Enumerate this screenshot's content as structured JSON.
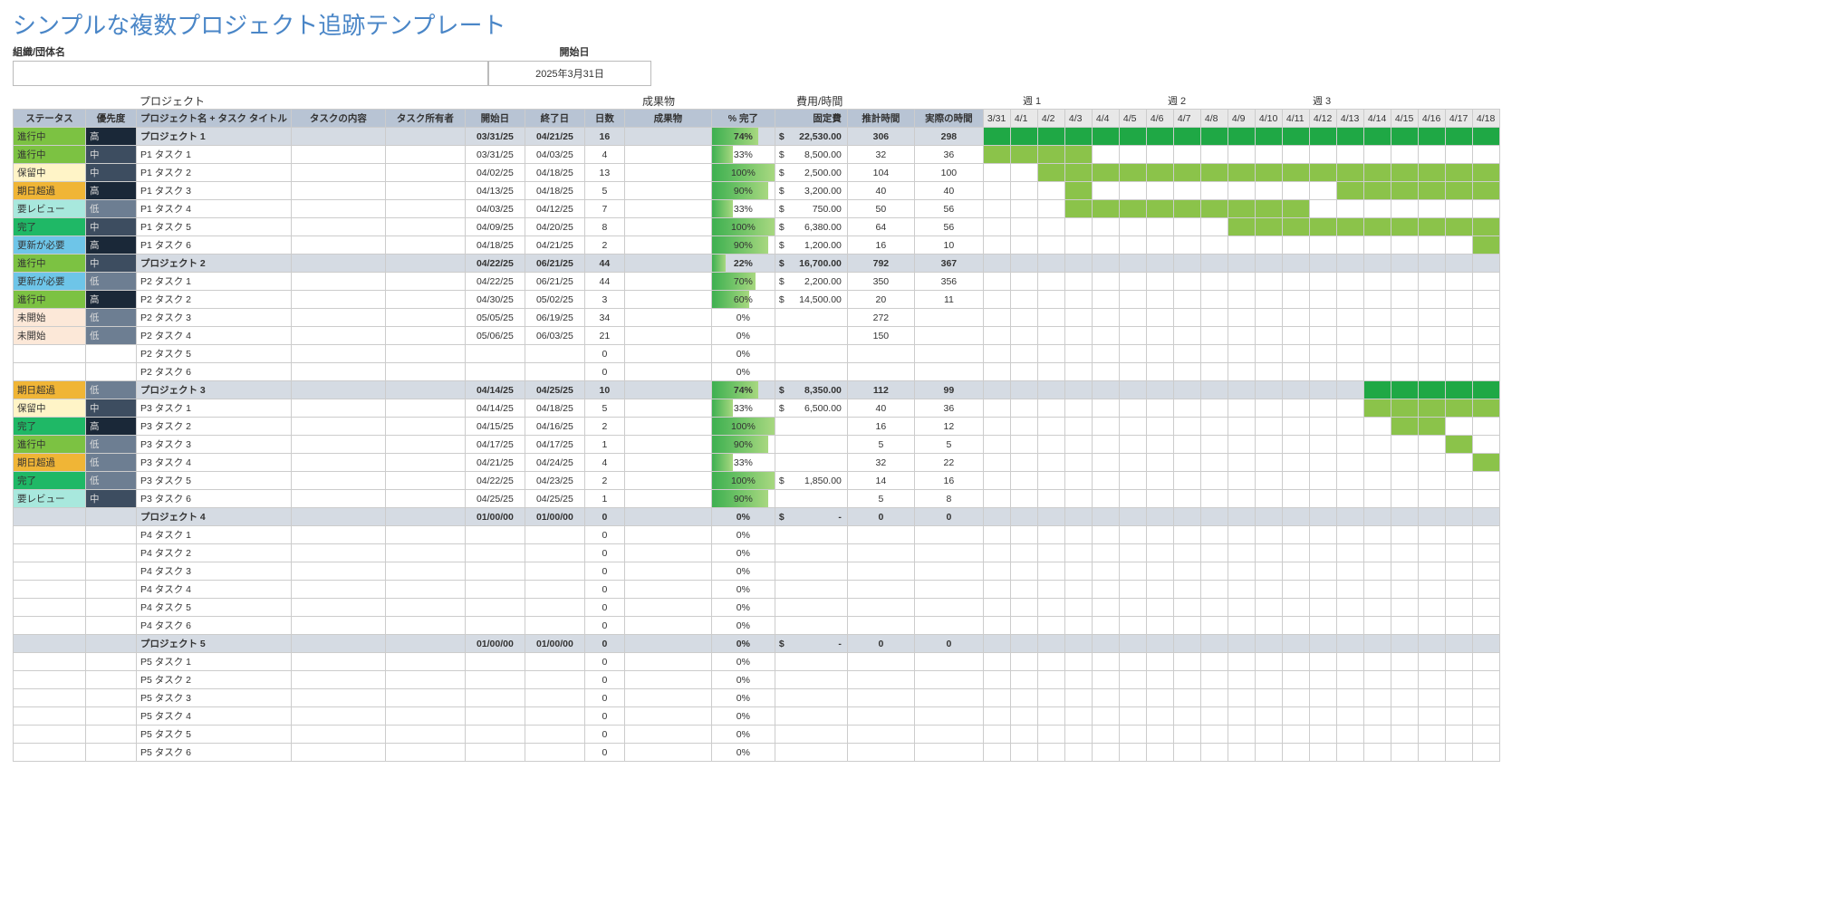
{
  "title": "シンプルな複数プロジェクト追跡テンプレート",
  "meta": {
    "org_label": "組織/団体名",
    "start_label": "開始日",
    "start_date": "2025年3月31日"
  },
  "sections": {
    "project": "プロジェクト",
    "deliv": "成果物",
    "cost": "費用/時間",
    "w1": "週 1",
    "w2": "週 2",
    "w3": "週 3"
  },
  "headers": {
    "status": "ステータス",
    "pri": "優先度",
    "name": "プロジェクト名 + タスク タイトル",
    "desc": "タスクの内容",
    "owner": "タスク所有者",
    "start": "開始日",
    "end": "終了日",
    "days": "日数",
    "del": "成果物",
    "pct": "% 完了",
    "cost": "固定費",
    "est": "推計時間",
    "act": "実際の時間"
  },
  "day_labels": [
    "3/31",
    "4/1",
    "4/2",
    "4/3",
    "4/4",
    "4/5",
    "4/6",
    "4/7",
    "4/8",
    "4/9",
    "4/10",
    "4/11",
    "4/12",
    "4/13",
    "4/14",
    "4/15",
    "4/16",
    "4/17",
    "4/18"
  ],
  "rows": [
    {
      "proj": true,
      "status": "進行中",
      "st": "inprog",
      "pri": "高",
      "pr": "high",
      "name": "プロジェクト 1",
      "start": "03/31/25",
      "end": "04/21/25",
      "days": "16",
      "pct": "74%",
      "pw": 74,
      "cost": "22,530.00",
      "est": "306",
      "act": "298",
      "g": [
        0,
        18,
        "head"
      ]
    },
    {
      "status": "進行中",
      "st": "inprog",
      "pri": "中",
      "pr": "mid",
      "name": "P1 タスク 1",
      "start": "03/31/25",
      "end": "04/03/25",
      "days": "4",
      "pct": "33%",
      "pw": 33,
      "cost": "8,500.00",
      "est": "32",
      "act": "36",
      "g": [
        0,
        3,
        "fill"
      ]
    },
    {
      "status": "保留中",
      "st": "hold",
      "pri": "中",
      "pr": "mid",
      "name": "P1 タスク 2",
      "start": "04/02/25",
      "end": "04/18/25",
      "days": "13",
      "pct": "100%",
      "pw": 100,
      "cost": "2,500.00",
      "est": "104",
      "act": "100",
      "g": [
        2,
        18,
        "fill"
      ]
    },
    {
      "status": "期日超過",
      "st": "overdue",
      "pri": "高",
      "pr": "high",
      "name": "P1 タスク 3",
      "start": "04/13/25",
      "end": "04/18/25",
      "days": "5",
      "pct": "90%",
      "pw": 90,
      "cost": "3,200.00",
      "est": "40",
      "act": "40",
      "g": [
        13,
        18,
        "fill"
      ],
      "g2": [
        3,
        3,
        "fill"
      ]
    },
    {
      "status": "要レビュー",
      "st": "review",
      "pri": "低",
      "pr": "low",
      "name": "P1 タスク 4",
      "start": "04/03/25",
      "end": "04/12/25",
      "days": "7",
      "pct": "33%",
      "pw": 33,
      "cost": "750.00",
      "est": "50",
      "act": "56",
      "g": [
        3,
        11,
        "fill"
      ]
    },
    {
      "status": "完了",
      "st": "done",
      "pri": "中",
      "pr": "mid",
      "name": "P1 タスク 5",
      "start": "04/09/25",
      "end": "04/20/25",
      "days": "8",
      "pct": "100%",
      "pw": 100,
      "cost": "6,380.00",
      "est": "64",
      "act": "56",
      "g": [
        9,
        18,
        "fill"
      ]
    },
    {
      "status": "更新が必要",
      "st": "update",
      "pri": "高",
      "pr": "high",
      "name": "P1 タスク 6",
      "start": "04/18/25",
      "end": "04/21/25",
      "days": "2",
      "pct": "90%",
      "pw": 90,
      "cost": "1,200.00",
      "est": "16",
      "act": "10",
      "g": [
        18,
        18,
        "fill"
      ]
    },
    {
      "proj": true,
      "status": "進行中",
      "st": "inprog",
      "pri": "中",
      "pr": "mid",
      "name": "プロジェクト 2",
      "start": "04/22/25",
      "end": "06/21/25",
      "days": "44",
      "pct": "22%",
      "pw": 22,
      "cost": "16,700.00",
      "est": "792",
      "act": "367",
      "g": [
        0,
        18,
        "light"
      ]
    },
    {
      "status": "更新が必要",
      "st": "update",
      "pri": "低",
      "pr": "low",
      "name": "P2 タスク 1",
      "start": "04/22/25",
      "end": "06/21/25",
      "days": "44",
      "pct": "70%",
      "pw": 70,
      "cost": "2,200.00",
      "est": "350",
      "act": "356"
    },
    {
      "status": "進行中",
      "st": "inprog",
      "pri": "高",
      "pr": "high",
      "name": "P2 タスク 2",
      "start": "04/30/25",
      "end": "05/02/25",
      "days": "3",
      "pct": "60%",
      "pw": 60,
      "cost": "14,500.00",
      "est": "20",
      "act": "11"
    },
    {
      "status": "未開始",
      "st": "notstart",
      "pri": "低",
      "pr": "low",
      "name": "P2 タスク 3",
      "start": "05/05/25",
      "end": "06/19/25",
      "days": "34",
      "pct": "0%",
      "pw": 0,
      "est": "272"
    },
    {
      "status": "未開始",
      "st": "notstart",
      "pri": "低",
      "pr": "low",
      "name": "P2 タスク 4",
      "start": "05/06/25",
      "end": "06/03/25",
      "days": "21",
      "pct": "0%",
      "pw": 0,
      "est": "150"
    },
    {
      "name": "P2 タスク 5",
      "days": "0",
      "pct": "0%",
      "pw": 0
    },
    {
      "name": "P2 タスク 6",
      "days": "0",
      "pct": "0%",
      "pw": 0
    },
    {
      "proj": true,
      "status": "期日超過",
      "st": "overdue",
      "pri": "低",
      "pr": "low",
      "name": "プロジェクト 3",
      "start": "04/14/25",
      "end": "04/25/25",
      "days": "10",
      "pct": "74%",
      "pw": 74,
      "cost": "8,350.00",
      "est": "112",
      "act": "99",
      "g": [
        14,
        18,
        "head"
      ],
      "g2": [
        0,
        13,
        "light"
      ]
    },
    {
      "status": "保留中",
      "st": "hold",
      "pri": "中",
      "pr": "mid",
      "name": "P3 タスク 1",
      "start": "04/14/25",
      "end": "04/18/25",
      "days": "5",
      "pct": "33%",
      "pw": 33,
      "cost": "6,500.00",
      "est": "40",
      "act": "36",
      "g": [
        14,
        18,
        "fill"
      ]
    },
    {
      "status": "完了",
      "st": "done",
      "pri": "高",
      "pr": "high",
      "name": "P3 タスク 2",
      "start": "04/15/25",
      "end": "04/16/25",
      "days": "2",
      "pct": "100%",
      "pw": 100,
      "est": "16",
      "act": "12",
      "g": [
        15,
        16,
        "fill"
      ]
    },
    {
      "status": "進行中",
      "st": "inprog",
      "pri": "低",
      "pr": "low",
      "name": "P3 タスク 3",
      "start": "04/17/25",
      "end": "04/17/25",
      "days": "1",
      "pct": "90%",
      "pw": 90,
      "est": "5",
      "act": "5",
      "g": [
        17,
        17,
        "fill"
      ]
    },
    {
      "status": "期日超過",
      "st": "overdue",
      "pri": "低",
      "pr": "low",
      "name": "P3 タスク 4",
      "start": "04/21/25",
      "end": "04/24/25",
      "days": "4",
      "pct": "33%",
      "pw": 33,
      "est": "32",
      "act": "22",
      "g": [
        18,
        18,
        "fill"
      ]
    },
    {
      "status": "完了",
      "st": "done",
      "pri": "低",
      "pr": "low",
      "name": "P3 タスク 5",
      "start": "04/22/25",
      "end": "04/23/25",
      "days": "2",
      "pct": "100%",
      "pw": 100,
      "cost": "1,850.00",
      "est": "14",
      "act": "16"
    },
    {
      "status": "要レビュー",
      "st": "review",
      "pri": "中",
      "pr": "mid",
      "name": "P3 タスク 6",
      "start": "04/25/25",
      "end": "04/25/25",
      "days": "1",
      "pct": "90%",
      "pw": 90,
      "est": "5",
      "act": "8"
    },
    {
      "proj": true,
      "name": "プロジェクト 4",
      "start": "01/00/00",
      "end": "01/00/00",
      "days": "0",
      "pct": "0%",
      "pw": 0,
      "cost": "-",
      "est": "0",
      "act": "0",
      "costDash": true,
      "g": [
        0,
        18,
        "light"
      ]
    },
    {
      "name": "P4 タスク 1",
      "days": "0",
      "pct": "0%",
      "pw": 0
    },
    {
      "name": "P4 タスク 2",
      "days": "0",
      "pct": "0%",
      "pw": 0
    },
    {
      "name": "P4 タスク 3",
      "days": "0",
      "pct": "0%",
      "pw": 0
    },
    {
      "name": "P4 タスク 4",
      "days": "0",
      "pct": "0%",
      "pw": 0
    },
    {
      "name": "P4 タスク 5",
      "days": "0",
      "pct": "0%",
      "pw": 0
    },
    {
      "name": "P4 タスク 6",
      "days": "0",
      "pct": "0%",
      "pw": 0
    },
    {
      "proj": true,
      "name": "プロジェクト 5",
      "start": "01/00/00",
      "end": "01/00/00",
      "days": "0",
      "pct": "0%",
      "pw": 0,
      "cost": "-",
      "est": "0",
      "act": "0",
      "costDash": true,
      "g": [
        0,
        18,
        "light"
      ]
    },
    {
      "name": "P5 タスク 1",
      "days": "0",
      "pct": "0%",
      "pw": 0
    },
    {
      "name": "P5 タスク 2",
      "days": "0",
      "pct": "0%",
      "pw": 0
    },
    {
      "name": "P5 タスク 3",
      "days": "0",
      "pct": "0%",
      "pw": 0
    },
    {
      "name": "P5 タスク 4",
      "days": "0",
      "pct": "0%",
      "pw": 0
    },
    {
      "name": "P5 タスク 5",
      "days": "0",
      "pct": "0%",
      "pw": 0
    },
    {
      "name": "P5 タスク 6",
      "days": "0",
      "pct": "0%",
      "pw": 0
    }
  ]
}
